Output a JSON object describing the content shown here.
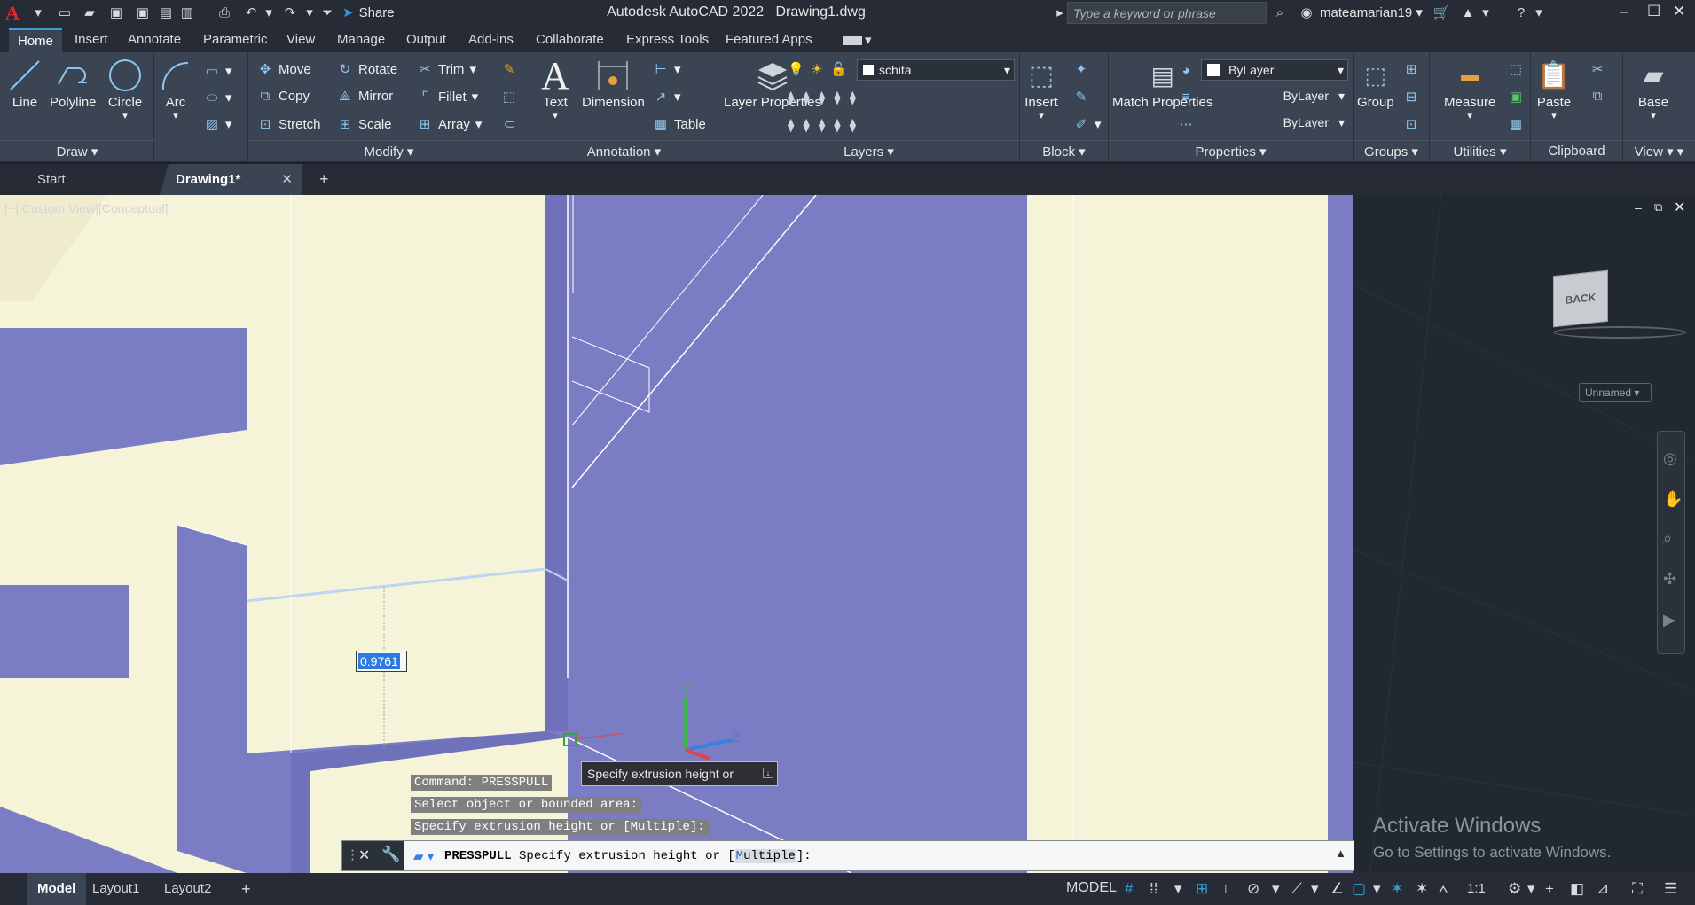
{
  "app": {
    "title": "Autodesk AutoCAD 2022",
    "file": "Drawing1.dwg",
    "logo": "A"
  },
  "quick_access": {
    "share_label": "Share"
  },
  "search": {
    "placeholder": "Type a keyword or phrase"
  },
  "user": {
    "name": "mateamarian19"
  },
  "menu_tabs": [
    "Home",
    "Insert",
    "Annotate",
    "Parametric",
    "View",
    "Manage",
    "Output",
    "Add-ins",
    "Collaborate",
    "Express Tools",
    "Featured Apps"
  ],
  "ribbon": {
    "draw": {
      "title": "Draw",
      "line": "Line",
      "polyline": "Polyline",
      "circle": "Circle",
      "arc": "Arc"
    },
    "modify": {
      "title": "Modify",
      "move": "Move",
      "rotate": "Rotate",
      "trim": "Trim",
      "copy": "Copy",
      "mirror": "Mirror",
      "fillet": "Fillet",
      "stretch": "Stretch",
      "scale": "Scale",
      "array": "Array"
    },
    "annotation": {
      "title": "Annotation",
      "text": "Text",
      "dimension": "Dimension",
      "table": "Table"
    },
    "layers": {
      "title": "Layers",
      "layer_properties": "Layer Properties",
      "current_layer": "schita"
    },
    "block": {
      "title": "Block",
      "insert": "Insert"
    },
    "properties": {
      "title": "Properties",
      "match": "Match Properties",
      "color": "ByLayer",
      "linetype": "ByLayer",
      "lineweight": "ByLayer"
    },
    "groups": {
      "title": "Groups",
      "group": "Group"
    },
    "utilities": {
      "title": "Utilities",
      "measure": "Measure"
    },
    "clipboard": {
      "title": "Clipboard",
      "paste": "Paste"
    },
    "view": {
      "title": "View",
      "base": "Base"
    }
  },
  "doc_tabs": {
    "start": "Start",
    "active": "Drawing1*",
    "close": "✕",
    "add": "+"
  },
  "viewport": {
    "label": "[−][Custom View][Conceptual]",
    "dynamic_input": "0.9761",
    "tooltip": "Specify extrusion height or",
    "history": [
      "Command: PRESSPULL",
      "Select object or bounded area:",
      "Specify extrusion height or [Multiple]:"
    ],
    "viewcube_label": "BACK",
    "ucs_label": "Unnamed"
  },
  "command_line": {
    "command": "PRESSPULL",
    "prompt": "Specify extrusion height or [",
    "option_key": "M",
    "option_rest": "ultiple",
    "suffix": "]:"
  },
  "layouts": {
    "model": "Model",
    "layout1": "Layout1",
    "layout2": "Layout2"
  },
  "status": {
    "model": "MODEL",
    "scale": "1:1"
  },
  "watermark": {
    "title": "Activate Windows",
    "subtitle": "Go to Settings to activate Windows."
  }
}
